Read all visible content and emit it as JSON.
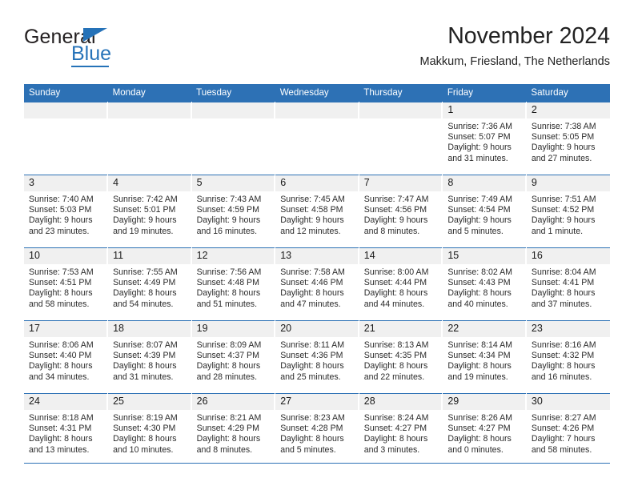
{
  "brand": {
    "name_top": "General",
    "name_bottom": "Blue",
    "accent_color": "#2572b8",
    "triangle_icon": "brand-triangle-icon"
  },
  "header": {
    "title": "November 2024",
    "subtitle": "Makkum, Friesland, The Netherlands"
  },
  "calendar": {
    "header_bg": "#2d71b5",
    "daynum_bg": "#f0f0f0",
    "weekday_headers": [
      "Sunday",
      "Monday",
      "Tuesday",
      "Wednesday",
      "Thursday",
      "Friday",
      "Saturday"
    ],
    "weeks": [
      [
        {
          "day": "",
          "blank": true,
          "lines": []
        },
        {
          "day": "",
          "blank": true,
          "lines": []
        },
        {
          "day": "",
          "blank": true,
          "lines": []
        },
        {
          "day": "",
          "blank": true,
          "lines": []
        },
        {
          "day": "",
          "blank": true,
          "lines": []
        },
        {
          "day": "1",
          "blank": false,
          "lines": [
            "Sunrise: 7:36 AM",
            "Sunset: 5:07 PM",
            "Daylight: 9 hours",
            "and 31 minutes."
          ]
        },
        {
          "day": "2",
          "blank": false,
          "lines": [
            "Sunrise: 7:38 AM",
            "Sunset: 5:05 PM",
            "Daylight: 9 hours",
            "and 27 minutes."
          ]
        }
      ],
      [
        {
          "day": "3",
          "blank": false,
          "lines": [
            "Sunrise: 7:40 AM",
            "Sunset: 5:03 PM",
            "Daylight: 9 hours",
            "and 23 minutes."
          ]
        },
        {
          "day": "4",
          "blank": false,
          "lines": [
            "Sunrise: 7:42 AM",
            "Sunset: 5:01 PM",
            "Daylight: 9 hours",
            "and 19 minutes."
          ]
        },
        {
          "day": "5",
          "blank": false,
          "lines": [
            "Sunrise: 7:43 AM",
            "Sunset: 4:59 PM",
            "Daylight: 9 hours",
            "and 16 minutes."
          ]
        },
        {
          "day": "6",
          "blank": false,
          "lines": [
            "Sunrise: 7:45 AM",
            "Sunset: 4:58 PM",
            "Daylight: 9 hours",
            "and 12 minutes."
          ]
        },
        {
          "day": "7",
          "blank": false,
          "lines": [
            "Sunrise: 7:47 AM",
            "Sunset: 4:56 PM",
            "Daylight: 9 hours",
            "and 8 minutes."
          ]
        },
        {
          "day": "8",
          "blank": false,
          "lines": [
            "Sunrise: 7:49 AM",
            "Sunset: 4:54 PM",
            "Daylight: 9 hours",
            "and 5 minutes."
          ]
        },
        {
          "day": "9",
          "blank": false,
          "lines": [
            "Sunrise: 7:51 AM",
            "Sunset: 4:52 PM",
            "Daylight: 9 hours",
            "and 1 minute."
          ]
        }
      ],
      [
        {
          "day": "10",
          "blank": false,
          "lines": [
            "Sunrise: 7:53 AM",
            "Sunset: 4:51 PM",
            "Daylight: 8 hours",
            "and 58 minutes."
          ]
        },
        {
          "day": "11",
          "blank": false,
          "lines": [
            "Sunrise: 7:55 AM",
            "Sunset: 4:49 PM",
            "Daylight: 8 hours",
            "and 54 minutes."
          ]
        },
        {
          "day": "12",
          "blank": false,
          "lines": [
            "Sunrise: 7:56 AM",
            "Sunset: 4:48 PM",
            "Daylight: 8 hours",
            "and 51 minutes."
          ]
        },
        {
          "day": "13",
          "blank": false,
          "lines": [
            "Sunrise: 7:58 AM",
            "Sunset: 4:46 PM",
            "Daylight: 8 hours",
            "and 47 minutes."
          ]
        },
        {
          "day": "14",
          "blank": false,
          "lines": [
            "Sunrise: 8:00 AM",
            "Sunset: 4:44 PM",
            "Daylight: 8 hours",
            "and 44 minutes."
          ]
        },
        {
          "day": "15",
          "blank": false,
          "lines": [
            "Sunrise: 8:02 AM",
            "Sunset: 4:43 PM",
            "Daylight: 8 hours",
            "and 40 minutes."
          ]
        },
        {
          "day": "16",
          "blank": false,
          "lines": [
            "Sunrise: 8:04 AM",
            "Sunset: 4:41 PM",
            "Daylight: 8 hours",
            "and 37 minutes."
          ]
        }
      ],
      [
        {
          "day": "17",
          "blank": false,
          "lines": [
            "Sunrise: 8:06 AM",
            "Sunset: 4:40 PM",
            "Daylight: 8 hours",
            "and 34 minutes."
          ]
        },
        {
          "day": "18",
          "blank": false,
          "lines": [
            "Sunrise: 8:07 AM",
            "Sunset: 4:39 PM",
            "Daylight: 8 hours",
            "and 31 minutes."
          ]
        },
        {
          "day": "19",
          "blank": false,
          "lines": [
            "Sunrise: 8:09 AM",
            "Sunset: 4:37 PM",
            "Daylight: 8 hours",
            "and 28 minutes."
          ]
        },
        {
          "day": "20",
          "blank": false,
          "lines": [
            "Sunrise: 8:11 AM",
            "Sunset: 4:36 PM",
            "Daylight: 8 hours",
            "and 25 minutes."
          ]
        },
        {
          "day": "21",
          "blank": false,
          "lines": [
            "Sunrise: 8:13 AM",
            "Sunset: 4:35 PM",
            "Daylight: 8 hours",
            "and 22 minutes."
          ]
        },
        {
          "day": "22",
          "blank": false,
          "lines": [
            "Sunrise: 8:14 AM",
            "Sunset: 4:34 PM",
            "Daylight: 8 hours",
            "and 19 minutes."
          ]
        },
        {
          "day": "23",
          "blank": false,
          "lines": [
            "Sunrise: 8:16 AM",
            "Sunset: 4:32 PM",
            "Daylight: 8 hours",
            "and 16 minutes."
          ]
        }
      ],
      [
        {
          "day": "24",
          "blank": false,
          "lines": [
            "Sunrise: 8:18 AM",
            "Sunset: 4:31 PM",
            "Daylight: 8 hours",
            "and 13 minutes."
          ]
        },
        {
          "day": "25",
          "blank": false,
          "lines": [
            "Sunrise: 8:19 AM",
            "Sunset: 4:30 PM",
            "Daylight: 8 hours",
            "and 10 minutes."
          ]
        },
        {
          "day": "26",
          "blank": false,
          "lines": [
            "Sunrise: 8:21 AM",
            "Sunset: 4:29 PM",
            "Daylight: 8 hours",
            "and 8 minutes."
          ]
        },
        {
          "day": "27",
          "blank": false,
          "lines": [
            "Sunrise: 8:23 AM",
            "Sunset: 4:28 PM",
            "Daylight: 8 hours",
            "and 5 minutes."
          ]
        },
        {
          "day": "28",
          "blank": false,
          "lines": [
            "Sunrise: 8:24 AM",
            "Sunset: 4:27 PM",
            "Daylight: 8 hours",
            "and 3 minutes."
          ]
        },
        {
          "day": "29",
          "blank": false,
          "lines": [
            "Sunrise: 8:26 AM",
            "Sunset: 4:27 PM",
            "Daylight: 8 hours",
            "and 0 minutes."
          ]
        },
        {
          "day": "30",
          "blank": false,
          "lines": [
            "Sunrise: 8:27 AM",
            "Sunset: 4:26 PM",
            "Daylight: 7 hours",
            "and 58 minutes."
          ]
        }
      ]
    ]
  }
}
